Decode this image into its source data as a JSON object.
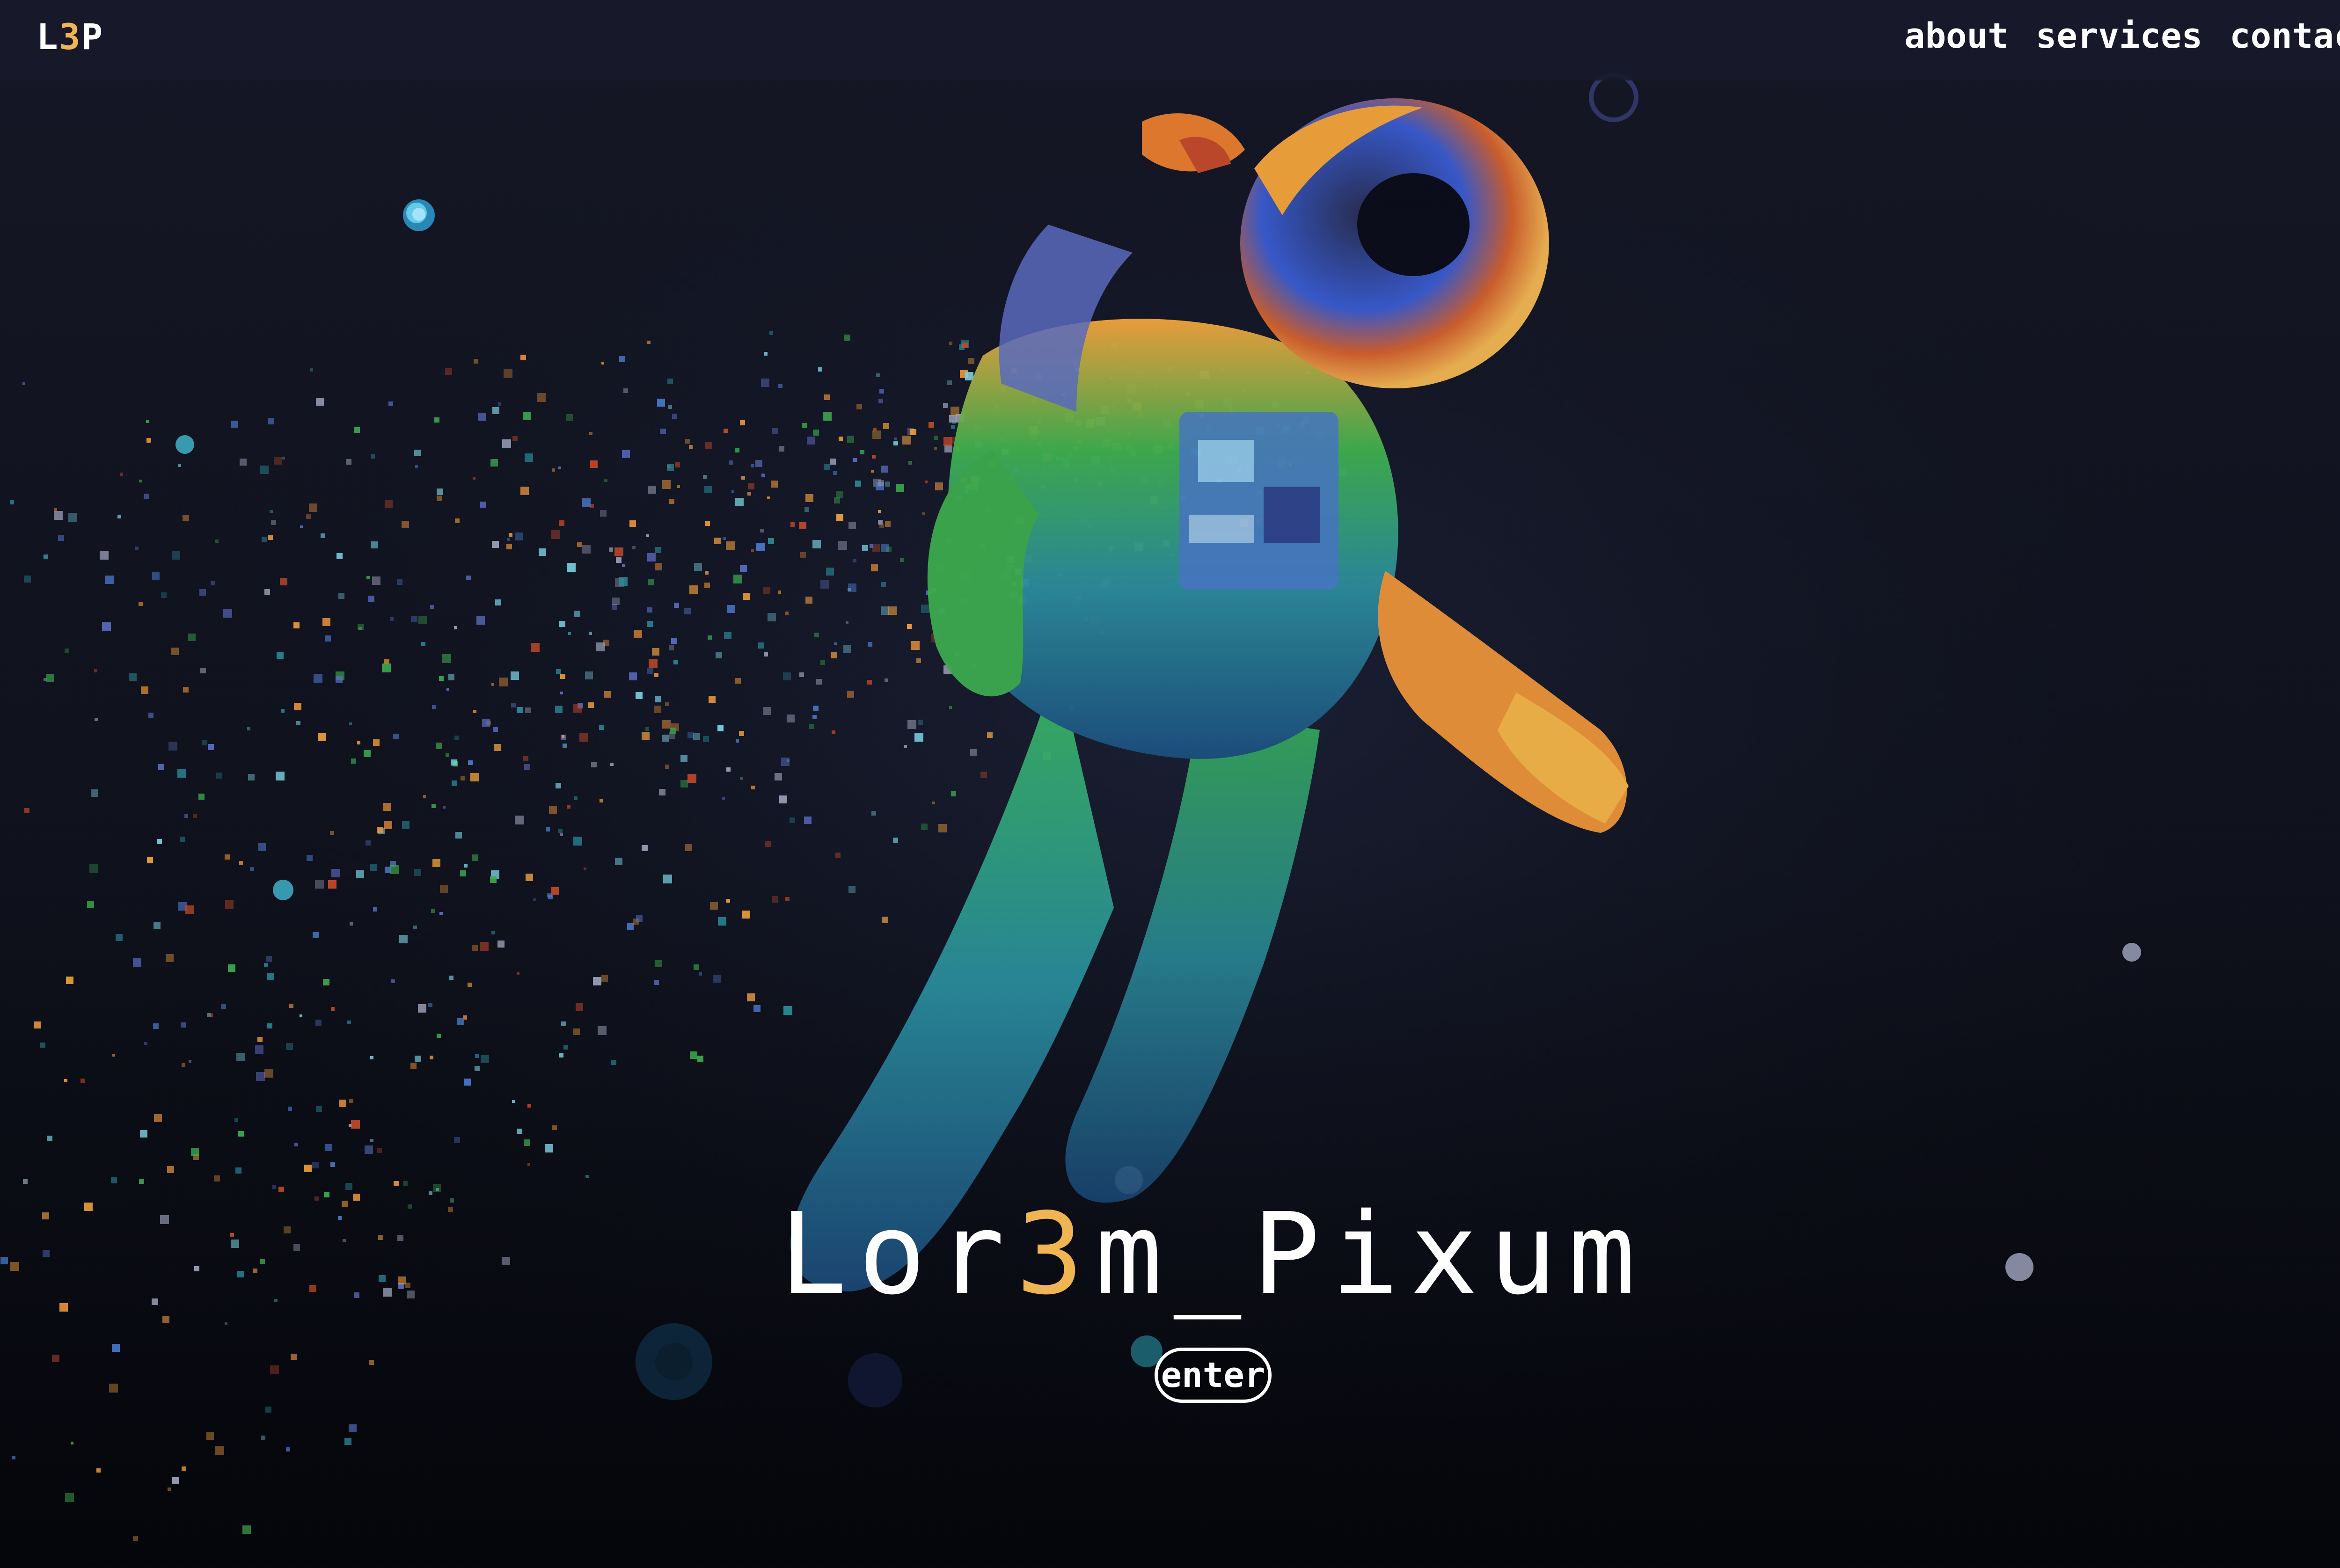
{
  "header": {
    "logo_prefix": "L",
    "logo_accent": "3",
    "logo_suffix": "P",
    "nav": [
      "about",
      "services",
      "contact"
    ]
  },
  "hero": {
    "title_prefix": "Lor",
    "title_accent": "3",
    "title_suffix": "m_Pixum",
    "enter_label": "enter"
  },
  "colors": {
    "accent": "#f0b453",
    "background_top": "#151726",
    "background_bottom": "#05060b",
    "text": "#ffffff"
  },
  "icons": {
    "hero_art": "pixel-astronaut-illustration"
  }
}
